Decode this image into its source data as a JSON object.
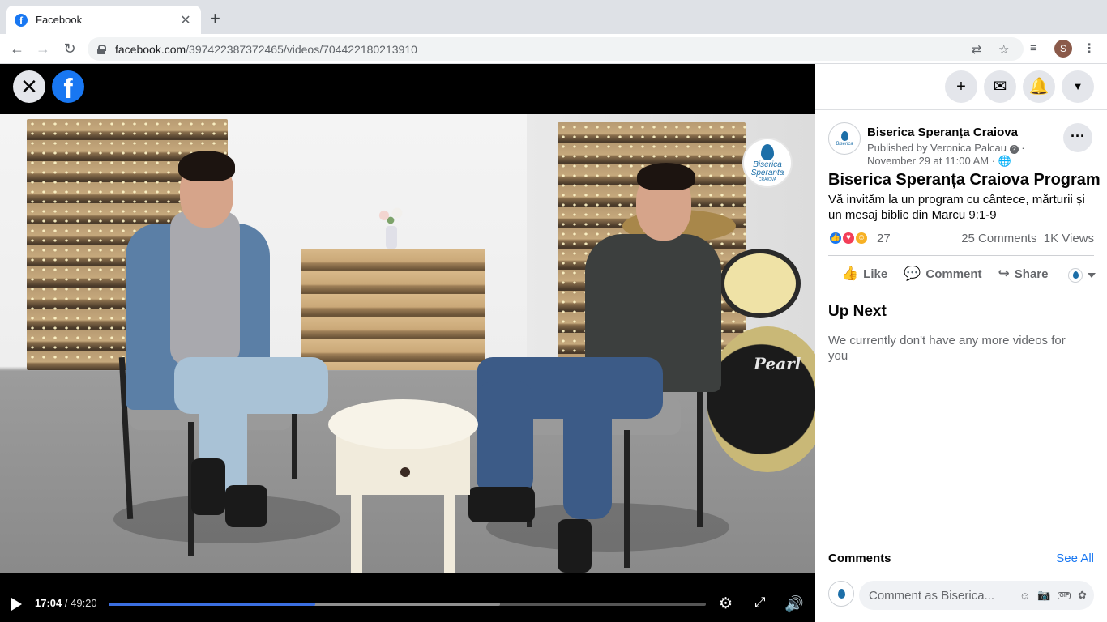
{
  "browser": {
    "tab_title": "Facebook",
    "tab_favicon": "f",
    "url_host": "facebook.com",
    "url_path": "/397422387372465/videos/704422180213910",
    "profile_initial": "S"
  },
  "video": {
    "current_time": "17:04",
    "duration": "49:20",
    "progress_fraction": 0.3459,
    "buffered_fraction": 0.655,
    "watermark_line1": "Biserica",
    "watermark_line2": "Speranta",
    "watermark_line3": "CRAIOVA",
    "set_brand": "Pearl"
  },
  "post": {
    "page_name": "Biserica Speranța Craiova",
    "published_by": "Published by Veronica Palcau",
    "date": "November 29 at 11:00 AM",
    "title": "Biserica Speranța Craiova Program",
    "description": "Vă invităm la un program cu cântece, mărturii și un mesaj biblic din Marcu 9:1-9",
    "reaction_count": "27",
    "comments_count": "25 Comments",
    "views_count": "1K Views",
    "like_label": "Like",
    "comment_label": "Comment",
    "share_label": "Share"
  },
  "up_next": {
    "heading": "Up Next",
    "message": "We currently don't have any more videos for you"
  },
  "comments": {
    "heading": "Comments",
    "see_all": "See All",
    "placeholder": "Comment as Biserica..."
  },
  "colors": {
    "brand": "#1877f2",
    "progress": "#3b6fe0"
  }
}
